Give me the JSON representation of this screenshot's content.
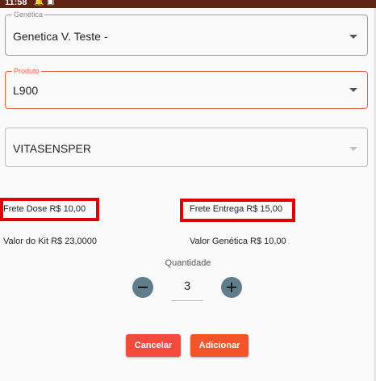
{
  "status_bar": {
    "time": "11:58",
    "icons": [
      "bell-icon",
      "a-box-icon"
    ]
  },
  "form": {
    "genetica": {
      "label": "Genética",
      "value": "Genetica V. Teste -"
    },
    "produto": {
      "label": "Produto",
      "value": "L900"
    },
    "vitasensper": {
      "value": "VITASENSPER"
    }
  },
  "info": {
    "frete_dose": "Frete Dose R$ 10,00",
    "frete_entrega": "Frete Entrega R$ 15,00",
    "valor_kit": "Valor do Kit R$ 23,0000",
    "valor_genetica": "Valor Genética R$ 10,00"
  },
  "quantity": {
    "label": "Quantidade",
    "value": "3"
  },
  "actions": {
    "cancel_label": "Cancelar",
    "add_label": "Adicionar"
  },
  "colors": {
    "status_bar": "#5d2414",
    "accent": "#e8623d",
    "cancel": "#f4493d",
    "add": "#f4542a",
    "stepper": "#607d8b",
    "highlight_box": "#e00000"
  }
}
